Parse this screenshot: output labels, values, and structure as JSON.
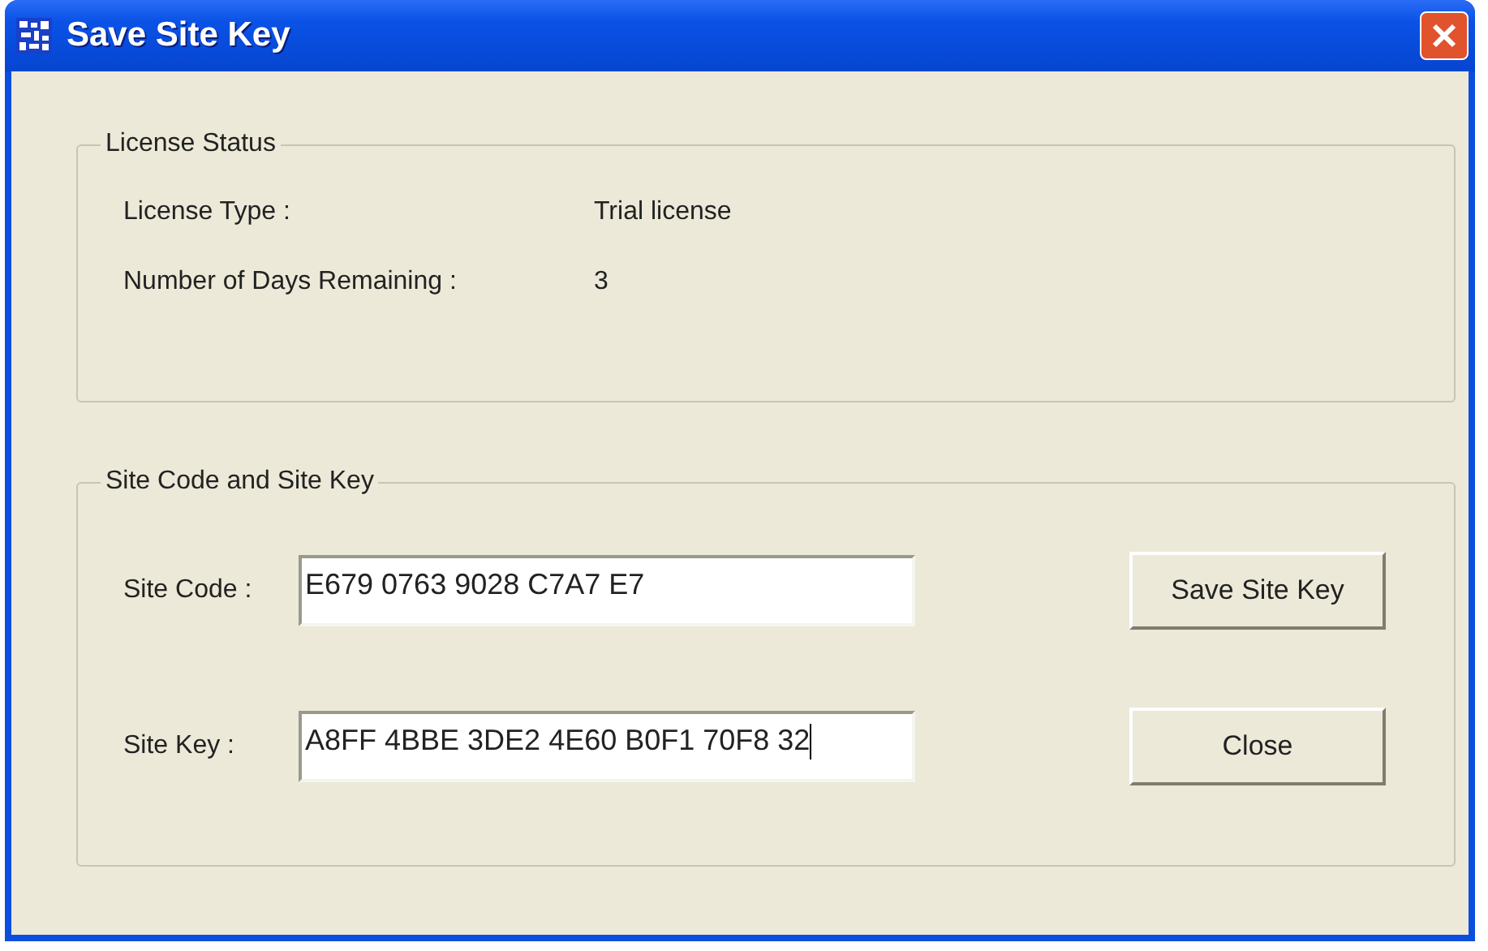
{
  "window": {
    "title": "Save Site Key"
  },
  "license_status": {
    "title": "License Status",
    "rows": [
      {
        "label": "License Type :",
        "value": "Trial license"
      },
      {
        "label": "Number of Days Remaining :",
        "value": "3"
      }
    ]
  },
  "site_group": {
    "title": "Site Code and Site Key",
    "fields": [
      {
        "label": "Site Code :",
        "value": "E679 0763 9028 C7A7 E7",
        "focused": false
      },
      {
        "label": "Site Key :",
        "value": "A8FF 4BBE 3DE2 4E60 B0F1 70F8 32",
        "focused": true
      }
    ],
    "buttons": [
      "Save Site Key",
      "Close"
    ]
  }
}
